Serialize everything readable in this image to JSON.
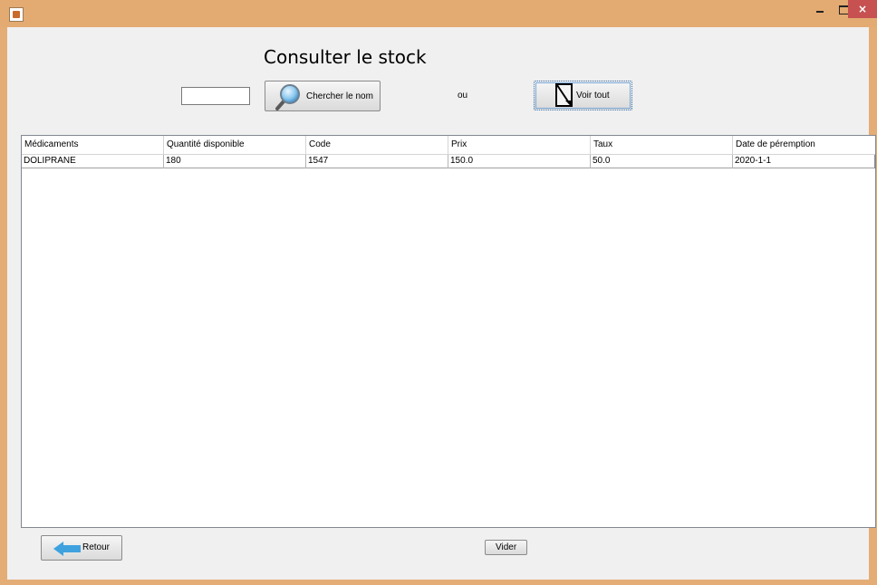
{
  "window": {
    "title": "",
    "controls": {
      "minimize": "minimize-icon",
      "maximize": "maximize-icon",
      "close": "×"
    }
  },
  "header": {
    "title": "Consulter le stock"
  },
  "search": {
    "value": "",
    "button_label": "Chercher le nom",
    "icon": "magnifier-icon",
    "separator": "ou",
    "show_all_label": "Voir tout",
    "show_all_icon": "document-icon"
  },
  "table": {
    "columns": [
      "Médicaments",
      "Quantité disponible",
      "Code",
      "Prix",
      "Taux",
      "Date de péremption"
    ],
    "rows": [
      [
        "DOLIPRANE",
        "180",
        "1547",
        "150.0",
        "50.0",
        "2020-1-1"
      ]
    ]
  },
  "footer": {
    "back_label": "Retour",
    "back_icon": "arrow-left-icon",
    "clear_label": "Vider"
  },
  "colors": {
    "window_frame": "#e3aa72",
    "close_button": "#c75050",
    "panel_background": "#f0f0f0",
    "arrow_accent": "#3fa2df"
  }
}
